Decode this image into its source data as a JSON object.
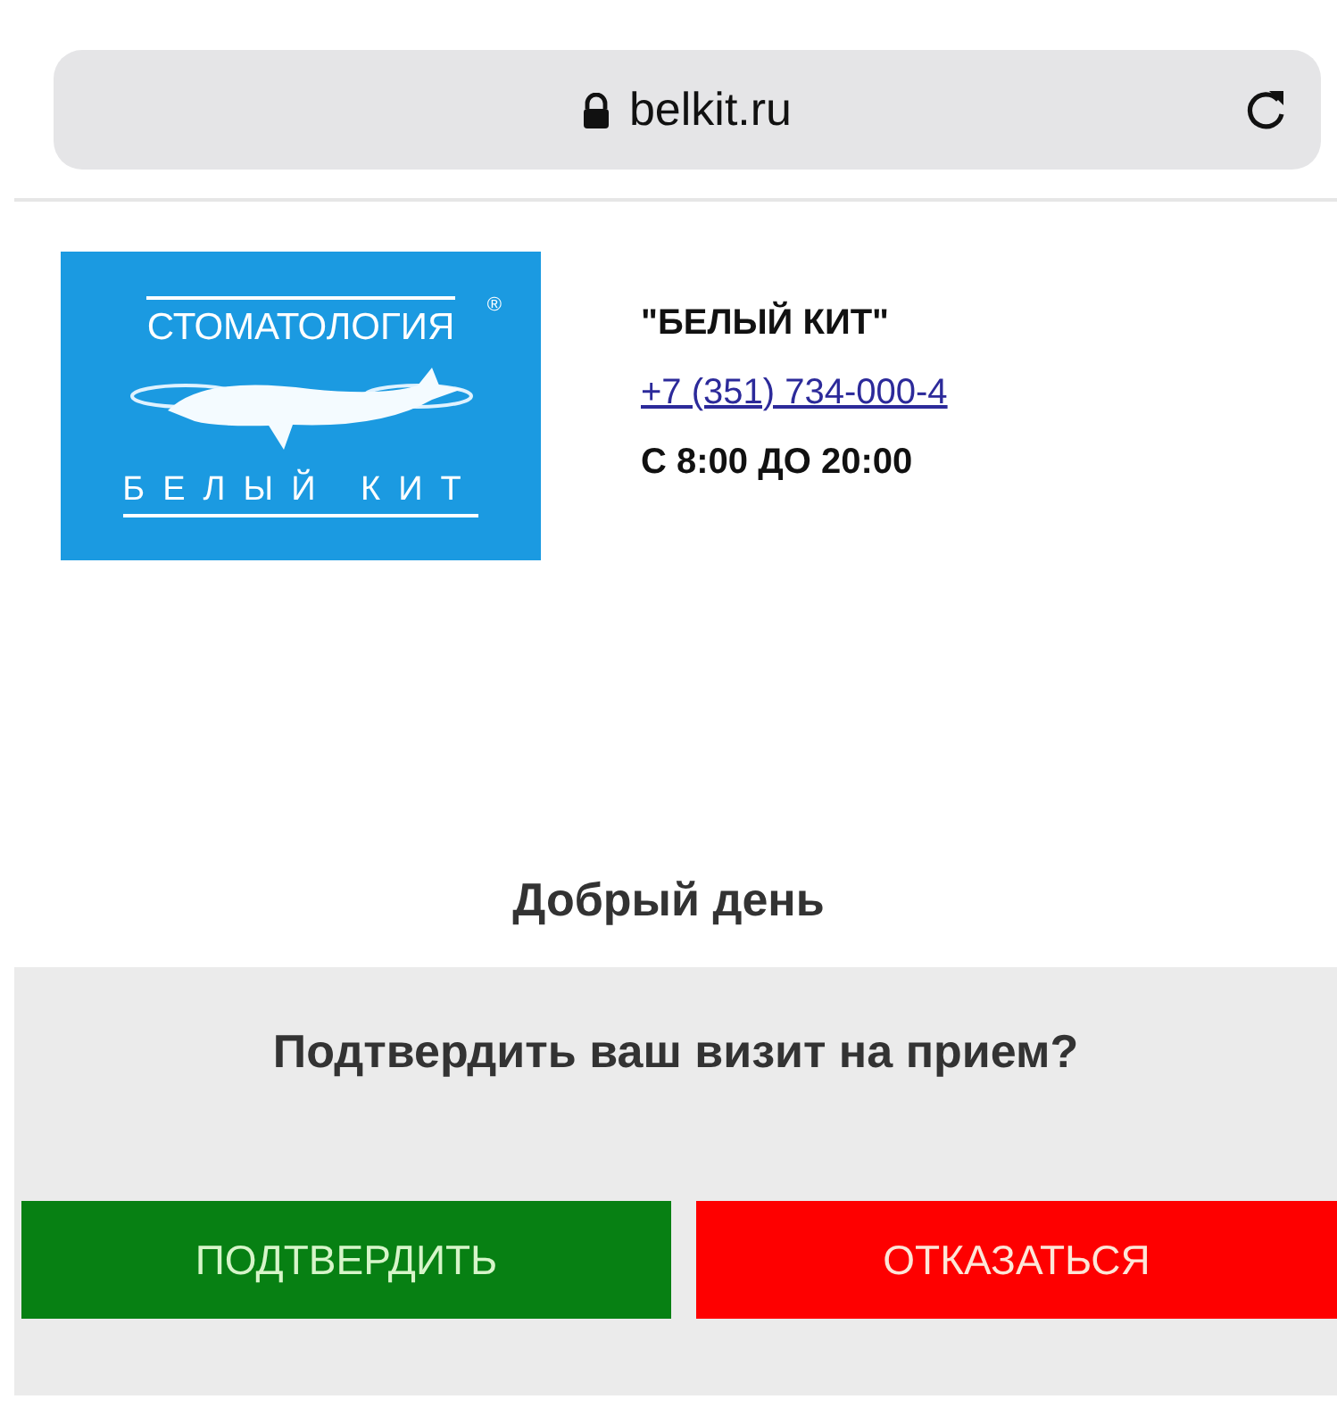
{
  "address_bar": {
    "url": "belkit.ru"
  },
  "logo": {
    "top_text": "СТОМАТОЛОГИЯ",
    "mark": "®",
    "bottom_text": "БЕЛЫЙ КИТ"
  },
  "clinic": {
    "name": "\"БЕЛЫЙ КИТ\"",
    "phone": "+7 (351) 734-000-4",
    "hours": "С 8:00 ДО 20:00"
  },
  "greeting": "Добрый день",
  "question": "Подтвердить ваш визит на прием?",
  "buttons": [
    {
      "label": "ПОДТВЕРДИТЬ",
      "kind": "confirm"
    },
    {
      "label": "ОТКАЗАТЬСЯ",
      "kind": "decline"
    }
  ]
}
